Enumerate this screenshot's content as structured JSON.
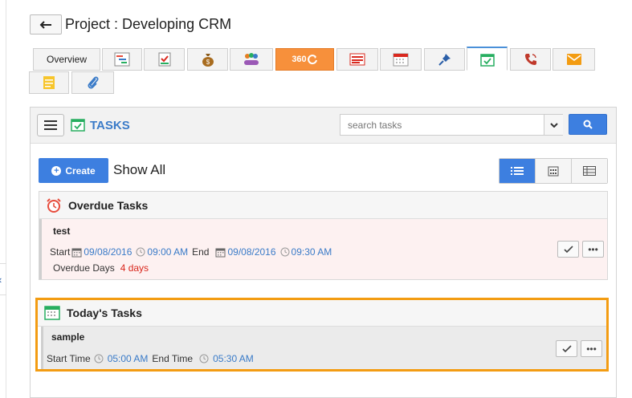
{
  "header": {
    "back_icon": "arrow-left-icon",
    "title": "Project : Developing CRM"
  },
  "tabs": [
    {
      "label": "Overview",
      "icon": ""
    },
    {
      "label": "",
      "icon": "gantt-icon"
    },
    {
      "label": "",
      "icon": "checklist-icon"
    },
    {
      "label": "",
      "icon": "money-bag-icon"
    },
    {
      "label": "",
      "icon": "team-icon"
    },
    {
      "label": "360",
      "icon": "refresh-360-icon"
    },
    {
      "label": "",
      "icon": "list-red-icon"
    },
    {
      "label": "",
      "icon": "calendar-icon"
    },
    {
      "label": "",
      "icon": "pin-icon"
    },
    {
      "label": "",
      "icon": "tasks-icon"
    },
    {
      "label": "",
      "icon": "phone-icon"
    },
    {
      "label": "",
      "icon": "mail-icon"
    },
    {
      "label": "",
      "icon": "notes-icon"
    },
    {
      "label": "",
      "icon": "paperclip-icon"
    }
  ],
  "panel": {
    "title": "TASKS",
    "search_placeholder": "search tasks",
    "create_label": "Create",
    "filter_label": "Show All"
  },
  "overdue": {
    "title": "Overdue Tasks",
    "task": {
      "name": "test",
      "start_label": "Start",
      "start_date": "09/08/2016",
      "start_time": "09:00 AM",
      "end_label": "End",
      "end_date": "09/08/2016",
      "end_time": "09:30 AM",
      "overdue_label": "Overdue Days",
      "overdue_value": "4 days"
    }
  },
  "today": {
    "title": "Today's Tasks",
    "task": {
      "name": "sample",
      "start_label": "Start Time",
      "start_time": "05:00 AM",
      "end_label": "End Time",
      "end_time": "05:30 AM"
    }
  },
  "colors": {
    "accent": "#3d7fe0",
    "highlight_border": "#f39c12",
    "overdue_bg": "#fdf1f1",
    "today_bg": "#ebebeb"
  }
}
